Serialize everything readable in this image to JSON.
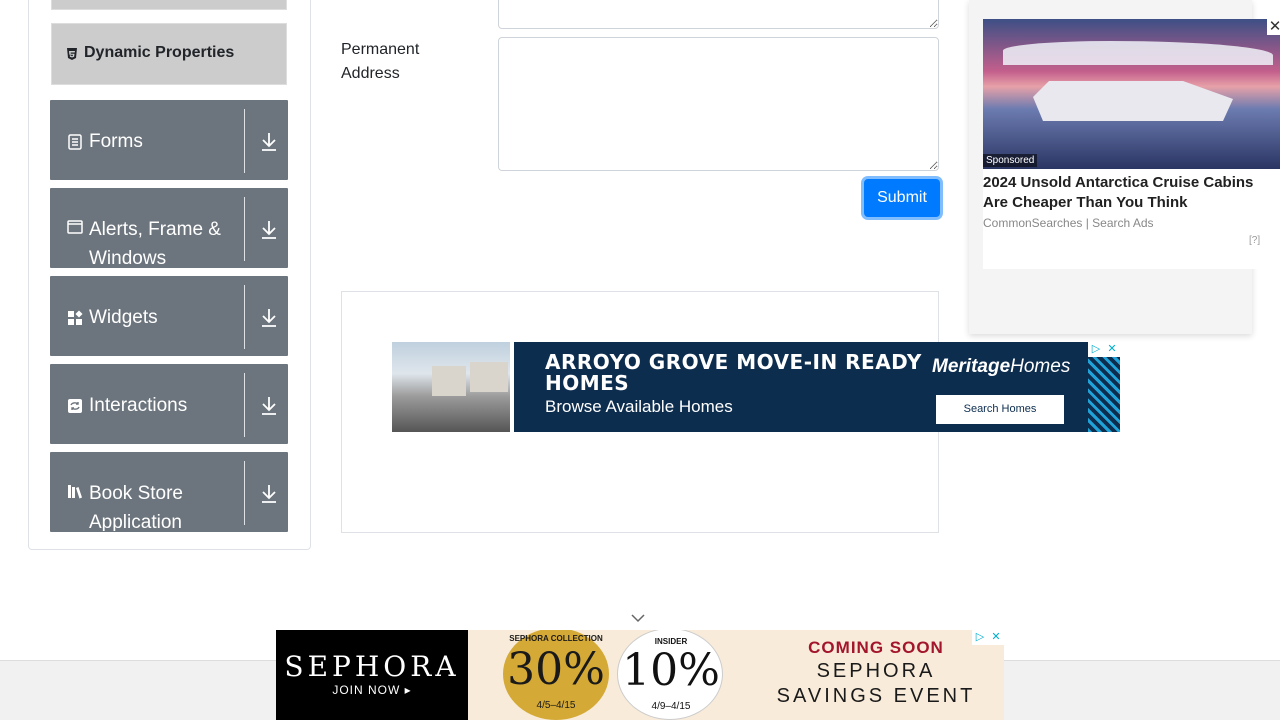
{
  "sidebar": {
    "sub_item": {
      "label": "Dynamic Properties",
      "icon": "html5-icon"
    },
    "groups": [
      {
        "label": "Forms",
        "icon": "form-icon"
      },
      {
        "label": "Alerts, Frame & Windows",
        "icon": "window-icon"
      },
      {
        "label": "Widgets",
        "icon": "widgets-icon"
      },
      {
        "label": "Interactions",
        "icon": "interactions-icon"
      },
      {
        "label": "Book Store Application",
        "icon": "books-icon"
      }
    ]
  },
  "form": {
    "permanent_address_label": "Permanent Address",
    "submit_label": "Submit"
  },
  "ads": {
    "middle": {
      "headline": "ARROYO GROVE MOVE-IN READY HOMES",
      "sub": "Browse Available Homes",
      "brand_a": "Meritage",
      "brand_b": "Homes",
      "cta": "Search Homes"
    },
    "right": {
      "sponsored": "Sponsored",
      "headline": "2024 Unsold Antarctica Cruise Cabins Are Cheaper Than You Think",
      "source": "CommonSearches | Search Ads",
      "info": "[?]"
    },
    "bottom": {
      "brand": "SEPHORA",
      "join": "JOIN NOW ▸",
      "d1_top": "SEPHORA COLLECTION",
      "d1_pct": "30%",
      "d1_date": "4/5–4/15",
      "d2_top": "INSIDER",
      "d2_pct": "10%",
      "d2_date": "4/9–4/15",
      "line1": "COMING SOON",
      "line2": "SEPHORA",
      "line3": "SAVINGS EVENT"
    }
  },
  "colors": {
    "accent": "#007bff",
    "group_bg": "#6c757d",
    "sub_item_bg": "#cccccc"
  }
}
